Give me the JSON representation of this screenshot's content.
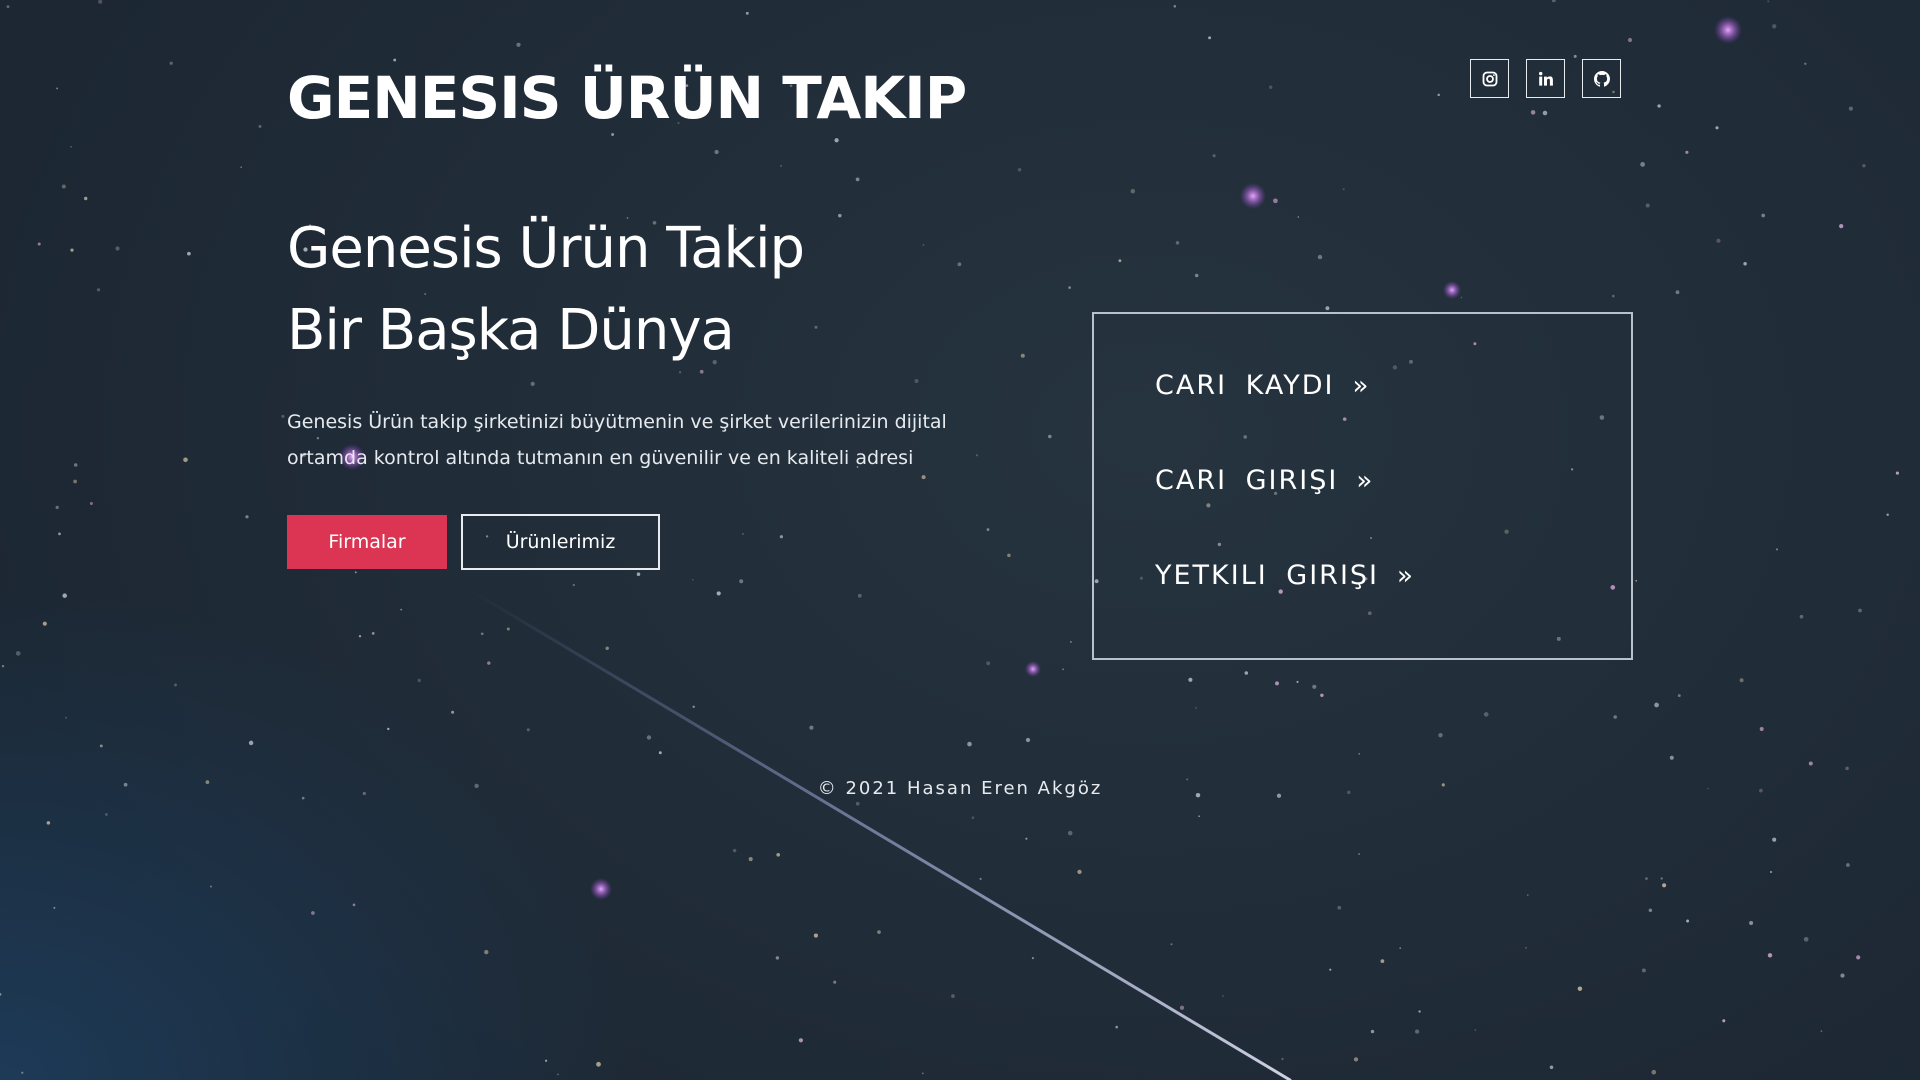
{
  "header": {
    "brand_title": "GENESIS ÜRÜN TAKIP"
  },
  "socials": [
    {
      "name": "instagram",
      "icon": "instagram-icon"
    },
    {
      "name": "linkedin",
      "icon": "linkedin-icon"
    },
    {
      "name": "github",
      "icon": "github-icon"
    }
  ],
  "hero": {
    "title_line1": "Genesis Ürün Takip",
    "title_line2": "Bir Başka Dünya",
    "description": "Genesis Ürün takip şirketinizi büyütmenin ve şirket verilerinizin dijital ortamda kontrol altında tutmanın en güvenilir ve en kaliteli adresi",
    "primary_button": "Firmalar",
    "secondary_button": "Ürünlerimiz"
  },
  "panel": {
    "links": [
      {
        "label": "CARI KAYDI",
        "arrow": "»"
      },
      {
        "label": "CARI GIRIŞI",
        "arrow": "»"
      },
      {
        "label": "YETKILI GIRIŞI",
        "arrow": "»"
      }
    ]
  },
  "footer": {
    "copyright": "© 2021 Hasan Eren Akgöz"
  },
  "colors": {
    "background": "#202c38",
    "accent": "#dc3554",
    "border": "#e8ecef"
  }
}
